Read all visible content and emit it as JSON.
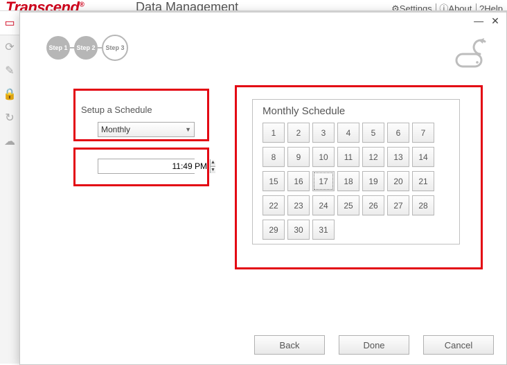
{
  "header": {
    "brand": "Transcend",
    "brand_reg": "®",
    "subtitle": "Data Management",
    "links": {
      "settings": "Settings",
      "about": "About",
      "help": "Help"
    }
  },
  "steps": {
    "s1": "Step 1",
    "s2": "Step 2",
    "s3": "Step 3"
  },
  "schedule": {
    "label": "Setup a Schedule",
    "mode": "Monthly",
    "time": "11:49 PM"
  },
  "monthly": {
    "title": "Monthly Schedule",
    "selected_day": 17,
    "days": [
      "1",
      "2",
      "3",
      "4",
      "5",
      "6",
      "7",
      "8",
      "9",
      "10",
      "11",
      "12",
      "13",
      "14",
      "15",
      "16",
      "17",
      "18",
      "19",
      "20",
      "21",
      "22",
      "23",
      "24",
      "25",
      "26",
      "27",
      "28",
      "29",
      "30",
      "31"
    ]
  },
  "buttons": {
    "back": "Back",
    "done": "Done",
    "cancel": "Cancel"
  },
  "highlight_color": "#e30613"
}
